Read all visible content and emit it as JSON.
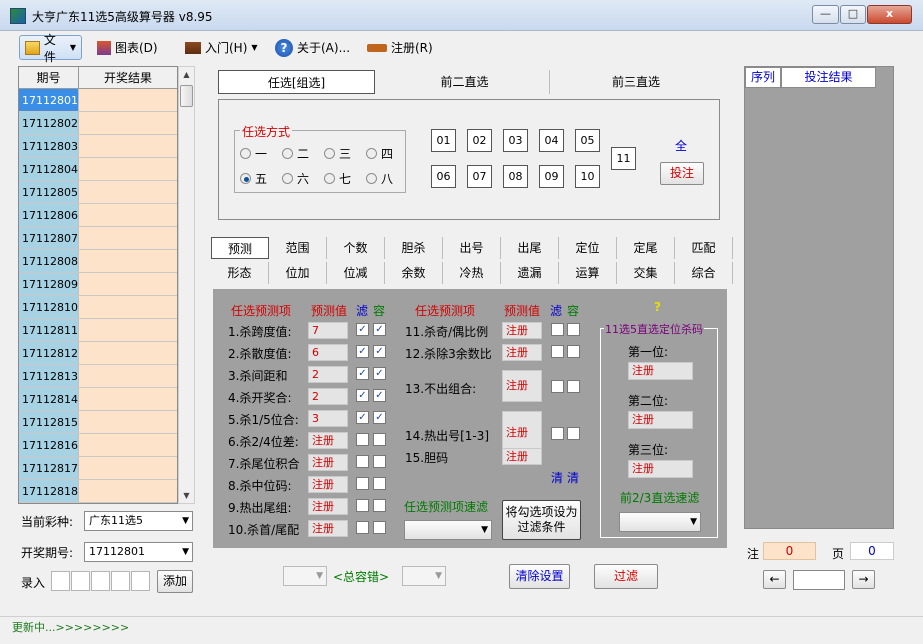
{
  "window": {
    "title": "大亨广东11选5高级算号器 v8.95",
    "min": "—",
    "max": "□",
    "close": "x"
  },
  "toolbar": {
    "file": "文件",
    "chart": "图表(D)",
    "intro": "入门(H)",
    "about": "关于(A)...",
    "register": "注册(R)"
  },
  "history": {
    "col_issue": "期号",
    "col_result": "开奖结果",
    "rows": [
      "17112801",
      "17112802",
      "17112803",
      "17112804",
      "17112805",
      "17112806",
      "17112807",
      "17112808",
      "17112809",
      "17112810",
      "17112811",
      "17112812",
      "17112813",
      "17112814",
      "17112815",
      "17112816",
      "17112817",
      "17112818"
    ]
  },
  "left_bottom": {
    "lottery_label": "当前彩种:",
    "lottery_value": "广东11选5",
    "issue_label": "开奖期号:",
    "issue_value": "17112801",
    "entry_label": "录入",
    "add_button": "添加"
  },
  "top_tabs": [
    "任选[组选]",
    "前二直选",
    "前三直选"
  ],
  "mode": {
    "title": "任选方式",
    "options": [
      "一",
      "二",
      "三",
      "四",
      "五",
      "六",
      "七",
      "八"
    ],
    "selected": "五"
  },
  "numbers": [
    "01",
    "02",
    "03",
    "04",
    "05",
    "06",
    "07",
    "08",
    "09",
    "10"
  ],
  "number_11": "11",
  "all_label": "全",
  "bet_button": "投注",
  "filter_tabs_row1": [
    "预测",
    "范围",
    "个数",
    "胆杀",
    "出号",
    "出尾",
    "定位",
    "定尾",
    "匹配"
  ],
  "filter_tabs_row2": [
    "形态",
    "位加",
    "位减",
    "余数",
    "冷热",
    "遗漏",
    "运算",
    "交集",
    "综合"
  ],
  "panel": {
    "h_item": "任选预测项",
    "h_value": "预测值",
    "h_filter": "滤",
    "h_tol": "容",
    "left_items": [
      {
        "label": "1.杀跨度值:",
        "value": "7",
        "f": true,
        "t": true
      },
      {
        "label": "2.杀散度值:",
        "value": "6",
        "f": true,
        "t": true
      },
      {
        "label": "3.杀间距和",
        "value": "2",
        "f": true,
        "t": true
      },
      {
        "label": "4.杀开奖合:",
        "value": "2",
        "f": true,
        "t": true
      },
      {
        "label": "5.杀1/5位合:",
        "value": "3",
        "f": true,
        "t": true
      },
      {
        "label": "6.杀2/4位差:",
        "value": "注册",
        "f": false,
        "t": false
      },
      {
        "label": "7.杀尾位积合",
        "value": "注册",
        "f": false,
        "t": false
      },
      {
        "label": "8.杀中位码:",
        "value": "注册",
        "f": false,
        "t": false
      },
      {
        "label": "9.热出尾组:",
        "value": "注册",
        "f": false,
        "t": false
      },
      {
        "label": "10.杀首/尾配",
        "value": "注册",
        "f": false,
        "t": false
      }
    ],
    "right_items": [
      {
        "label": "11.杀奇/偶比例",
        "value": "注册"
      },
      {
        "label": "12.杀除3余数比",
        "value": "注册"
      },
      {
        "label": "13.不出组合:",
        "value": "注册"
      },
      {
        "label": "14.热出号[1-3]",
        "value": "注册"
      },
      {
        "label": "15.胆码",
        "value": "注册"
      }
    ],
    "clear1": "清",
    "clear2": "清",
    "quick_filter_label": "任选预测项速滤",
    "set_filter_button": "将勾选项设为过滤条件",
    "question": "?",
    "kill_box_title": "11选5直选定位杀码",
    "pos1": "第一位:",
    "pos2": "第二位:",
    "pos3": "第三位:",
    "pos_value": "注册",
    "quick_direct_label": "前2/3直选速滤"
  },
  "bottom": {
    "total_tol": "<总容错>",
    "clear_settings": "清除设置",
    "filter_button": "过滤"
  },
  "right": {
    "col_seq": "序列",
    "col_result": "投注结果",
    "note_label": "注",
    "note_value": "0",
    "page_label": "页",
    "page_value": "0",
    "prev": "←",
    "next": "→"
  },
  "status": {
    "text": "更新中...>>>>>>>>"
  }
}
